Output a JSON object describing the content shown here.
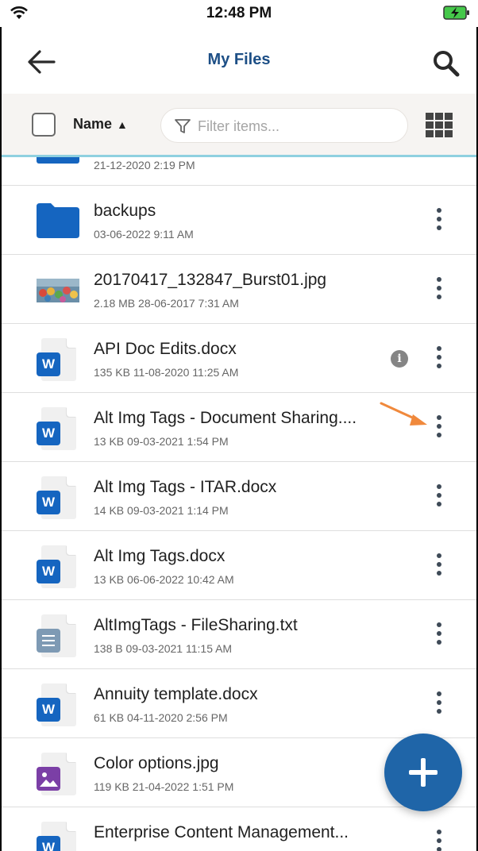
{
  "status_bar": {
    "time": "12:48 PM"
  },
  "header": {
    "title": "My Files"
  },
  "toolbar": {
    "sort_label": "Name",
    "sort_arrow": "▲",
    "filter_placeholder": "Filter items..."
  },
  "files": [
    {
      "meta": "21-12-2020 2:19 PM",
      "type": "folder"
    },
    {
      "name": "backups",
      "meta": "03-06-2022 9:11 AM",
      "type": "folder"
    },
    {
      "name": "20170417_132847_Burst01.jpg",
      "meta": "2.18 MB 28-06-2017 7:31 AM",
      "type": "photo"
    },
    {
      "name": "API Doc Edits.docx",
      "meta": "135 KB 11-08-2020 11:25 AM",
      "type": "word"
    },
    {
      "name": "Alt Img Tags - Document Sharing....",
      "meta": "13 KB 09-03-2021 1:54 PM",
      "type": "word"
    },
    {
      "name": "Alt Img Tags - ITAR.docx",
      "meta": "14 KB 09-03-2021 1:14 PM",
      "type": "word"
    },
    {
      "name": "Alt Img Tags.docx",
      "meta": "13 KB 06-06-2022 10:42 AM",
      "type": "word"
    },
    {
      "name": "AltImgTags - FileSharing.txt",
      "meta": "138 B 09-03-2021 11:15 AM",
      "type": "text"
    },
    {
      "name": "Annuity template.docx",
      "meta": "61 KB 04-11-2020 2:56 PM",
      "type": "word"
    },
    {
      "name": "Color options.jpg",
      "meta": "119 KB 21-04-2022 1:51 PM",
      "type": "image"
    },
    {
      "name": "Enterprise Content Management...",
      "type": "word"
    }
  ],
  "info_glyph": "i",
  "word_glyph": "W",
  "colors": {
    "accent": "#1f65a8",
    "title": "#1d4f86",
    "word": "#1565c0",
    "folder": "#1565c0",
    "annotation": "#f0893c"
  }
}
